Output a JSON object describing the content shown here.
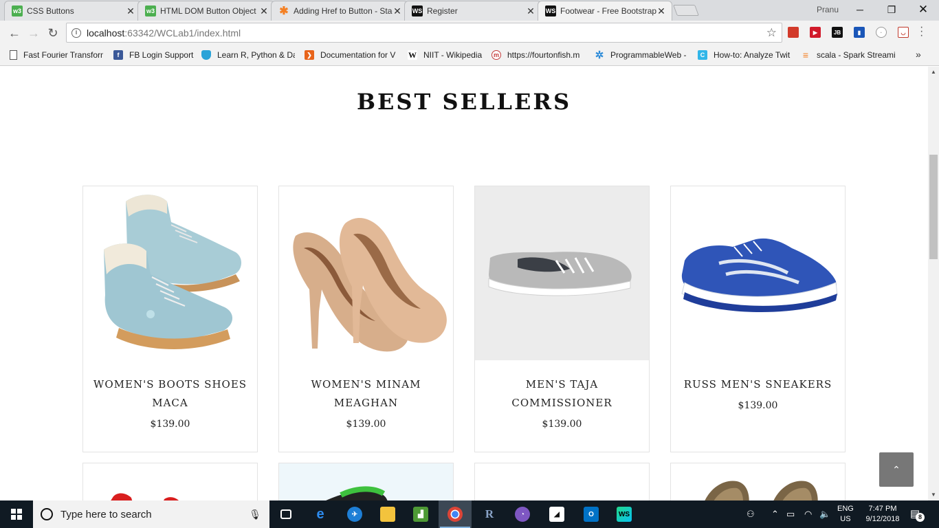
{
  "browser": {
    "tabs": [
      {
        "title": "CSS Buttons",
        "favicon": "w3schools-icon",
        "color": "#4caf50",
        "glyph": "w3"
      },
      {
        "title": "HTML DOM Button Object",
        "favicon": "w3schools-icon",
        "color": "#4caf50",
        "glyph": "w3"
      },
      {
        "title": "Adding Href to Button - Stack Overflow",
        "favicon": "asterisk-icon",
        "color": "#f48024",
        "glyph": "✱"
      },
      {
        "title": "Register",
        "favicon": "webstorm-icon",
        "color": "#111111",
        "glyph": "WS"
      },
      {
        "title": "Footwear - Free Bootstrap",
        "favicon": "webstorm-icon",
        "color": "#111111",
        "glyph": "WS"
      }
    ],
    "profile_name": "Pranu",
    "url_host": "localhost",
    "url_path": ":63342/WCLab1/index.html",
    "bookmarks": [
      {
        "label": "Fast Fourier Transform",
        "icon": "page-icon",
        "color": "#ffffff",
        "glyph": ""
      },
      {
        "label": "FB Login Support",
        "icon": "facebook-icon",
        "color": "#3b5998",
        "glyph": "f"
      },
      {
        "label": "Learn R, Python & Data",
        "icon": "shield-icon",
        "color": "#2aa3d8",
        "glyph": "◈"
      },
      {
        "label": "Documentation for V",
        "icon": "vscode-icon",
        "color": "#e8641b",
        "glyph": "❯"
      },
      {
        "label": "NIIT - Wikipedia",
        "icon": "wikipedia-icon",
        "color": "#ffffff",
        "glyph": "W"
      },
      {
        "label": "https://fourtonfish.m",
        "icon": "m-circle-icon",
        "color": "#c33b3b",
        "glyph": "m"
      },
      {
        "label": "ProgrammableWeb -",
        "icon": "puzzle-icon",
        "color": "#2d8bd8",
        "glyph": "✲"
      },
      {
        "label": "How-to: Analyze Twit",
        "icon": "c-icon",
        "color": "#31b6e8",
        "glyph": "C"
      },
      {
        "label": "scala - Spark Streamin",
        "icon": "stack-icon",
        "color": "#f48024",
        "glyph": "≡"
      }
    ],
    "more_bookmarks": "»"
  },
  "page": {
    "section_title": "BEST SELLERS",
    "products": [
      {
        "name": "WOMEN'S BOOTS SHOES MACA",
        "price": "$139.00",
        "image": "blue-boots-image",
        "bg": "#ffffff"
      },
      {
        "name": "WOMEN'S MINAM MEAGHAN",
        "price": "$139.00",
        "image": "tan-heels-image",
        "bg": "#ffffff"
      },
      {
        "name": "MEN'S TAJA COMMISSIONER",
        "price": "$139.00",
        "image": "grey-sneaker-image",
        "bg": "#ececec"
      },
      {
        "name": "RUSS MEN'S SNEAKERS",
        "price": "$139.00",
        "image": "blue-running-shoe-image",
        "bg": "#ffffff"
      }
    ],
    "scroll_top_icon": "chevron-up-icon",
    "scroll_position": 0.2
  },
  "taskbar": {
    "search_placeholder": "Type here to search",
    "language": "ENG",
    "region": "US",
    "time": "7:47 PM",
    "date": "9/12/2018",
    "notification_count": "8"
  }
}
